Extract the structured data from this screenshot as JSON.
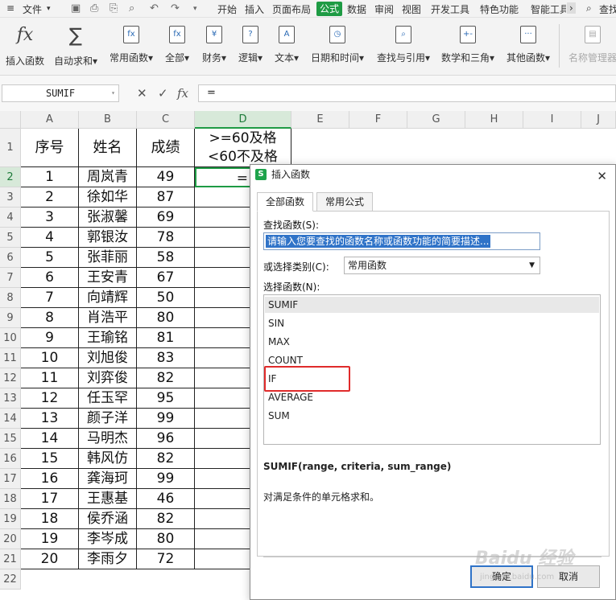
{
  "menubar": {
    "file": "文件",
    "items": [
      "开始",
      "插入",
      "页面布局",
      "公式",
      "数据",
      "审阅",
      "视图",
      "开发工具",
      "特色功能",
      "智能工具"
    ],
    "active": "公式",
    "search": "查找"
  },
  "ribbon": {
    "buttons": [
      {
        "label": "插入函数",
        "icon": "fx-icon"
      },
      {
        "label": "自动求和",
        "icon": "sigma-icon"
      },
      {
        "label": "常用函数",
        "icon": "star-fx-icon"
      },
      {
        "label": "全部",
        "icon": "fx-book-icon"
      },
      {
        "label": "财务",
        "icon": "yen-icon"
      },
      {
        "label": "逻辑",
        "icon": "question-icon"
      },
      {
        "label": "文本",
        "icon": "text-a-icon"
      },
      {
        "label": "日期和时间",
        "icon": "clock-icon"
      },
      {
        "label": "查找与引用",
        "icon": "magnifier-icon"
      },
      {
        "label": "数学和三角",
        "icon": "math-icon"
      },
      {
        "label": "其他函数",
        "icon": "dots-icon"
      },
      {
        "label": "名称管理器",
        "icon": "name-manager-icon"
      }
    ]
  },
  "formula_bar": {
    "name_box": "SUMIF",
    "formula": "="
  },
  "columns": [
    "A",
    "B",
    "C",
    "D",
    "E",
    "F",
    "G",
    "H",
    "I",
    "J"
  ],
  "rows": [
    "1",
    "2",
    "3",
    "4",
    "5",
    "6",
    "7",
    "8",
    "9",
    "10",
    "11",
    "12",
    "13",
    "14",
    "15",
    "16",
    "17",
    "18",
    "19",
    "20",
    "21",
    "22"
  ],
  "table": {
    "headers": [
      "序号",
      "姓名",
      "成绩",
      ">=60及格",
      "<60不及格"
    ],
    "d2": "=",
    "data": [
      [
        "1",
        "周岚青",
        "49"
      ],
      [
        "2",
        "徐如华",
        "87"
      ],
      [
        "3",
        "张淑馨",
        "69"
      ],
      [
        "4",
        "郭银汝",
        "78"
      ],
      [
        "5",
        "张菲丽",
        "58"
      ],
      [
        "6",
        "王安青",
        "67"
      ],
      [
        "7",
        "向靖辉",
        "50"
      ],
      [
        "8",
        "肖浩平",
        "80"
      ],
      [
        "9",
        "王瑜铭",
        "81"
      ],
      [
        "10",
        "刘旭俊",
        "83"
      ],
      [
        "11",
        "刘弈俊",
        "82"
      ],
      [
        "12",
        "任玉罕",
        "95"
      ],
      [
        "13",
        "颜子洋",
        "99"
      ],
      [
        "14",
        "马明杰",
        "96"
      ],
      [
        "15",
        "韩风仿",
        "82"
      ],
      [
        "16",
        "龚海珂",
        "99"
      ],
      [
        "17",
        "王惠基",
        "46"
      ],
      [
        "18",
        "侯乔涵",
        "82"
      ],
      [
        "19",
        "李岑成",
        "80"
      ],
      [
        "20",
        "李雨夕",
        "72"
      ]
    ]
  },
  "dialog": {
    "logo": "S",
    "title": "插入函数",
    "tabs": [
      "全部函数",
      "常用公式"
    ],
    "search_label": "查找函数(S):",
    "search_value": "请输入您要查找的函数名称或函数功能的简要描述...",
    "category_label": "或选择类别(C):",
    "category_value": "常用函数",
    "list_label": "选择函数(N):",
    "functions": [
      "SUMIF",
      "SIN",
      "MAX",
      "COUNT",
      "IF",
      "AVERAGE",
      "SUM"
    ],
    "signature": "SUMIF(range, criteria, sum_range)",
    "description": "对满足条件的单元格求和。",
    "ok": "确定",
    "cancel": "取消"
  },
  "watermark": {
    "text": "Baidu 经验",
    "sub": "jingyan.baidu.com"
  },
  "colors": {
    "accent": "#1e9b44",
    "highlight": "#e02b2b",
    "selection": "#2f73c8"
  }
}
